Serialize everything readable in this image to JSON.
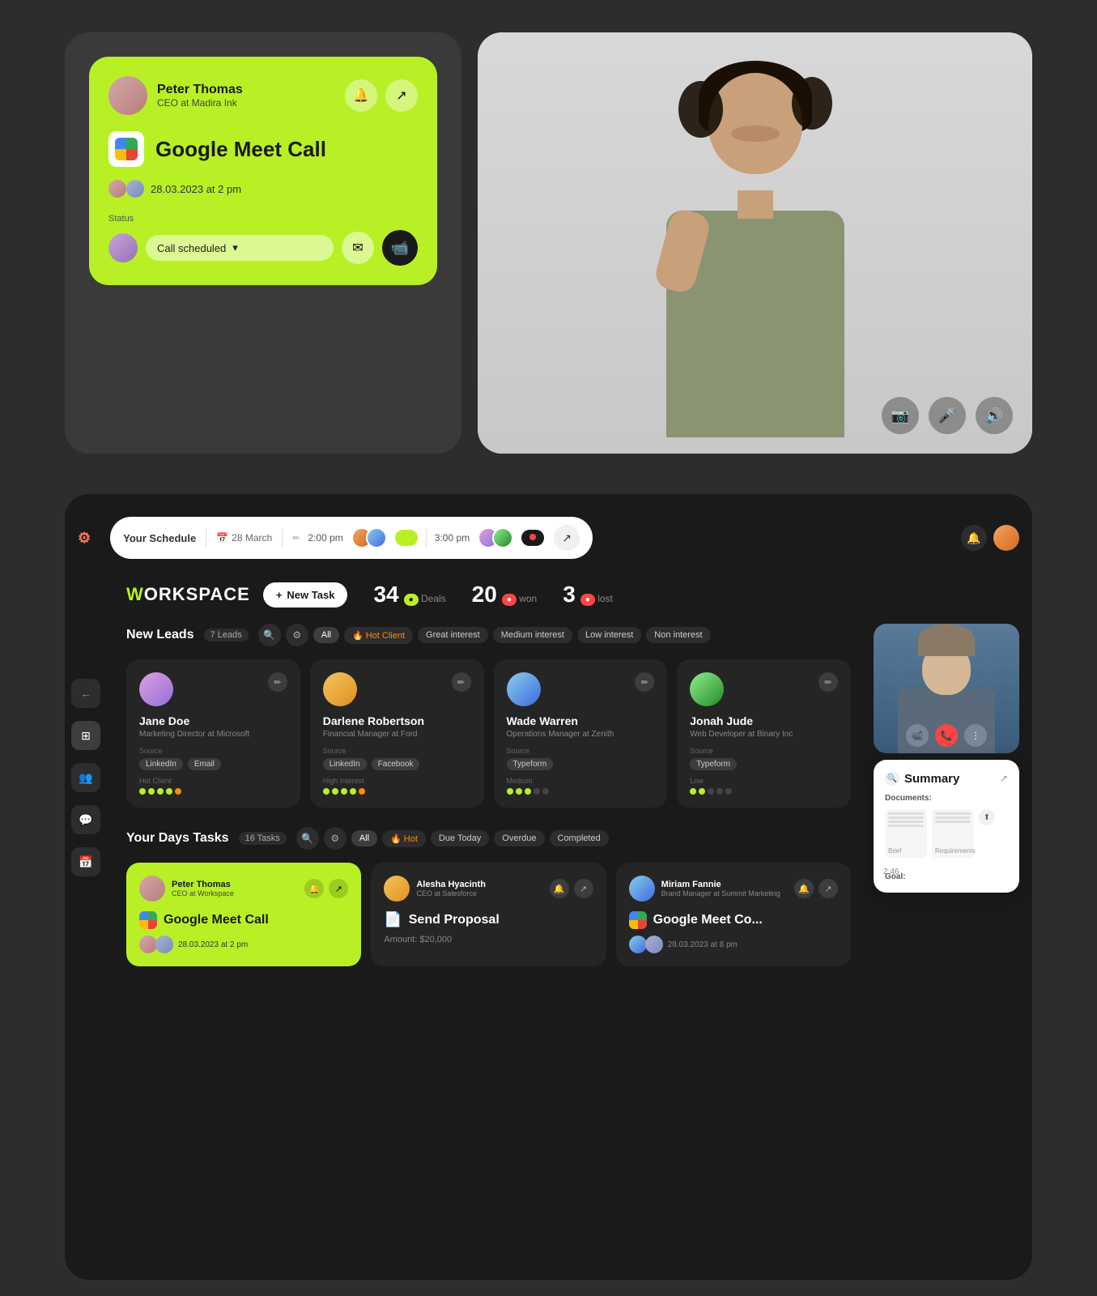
{
  "top_left_card": {
    "user_name": "Peter Thomas",
    "user_title": "CEO at Madira Ink",
    "bell_icon": "🔔",
    "expand_icon": "↗",
    "meet_title": "Google Meet Call",
    "meet_date": "28.03.2023",
    "meet_time": "at 2 pm",
    "status_label": "Status",
    "status_value": "Call scheduled",
    "chevron": "▾"
  },
  "video_call": {
    "camera_icon": "📷",
    "mic_icon": "🎤",
    "speaker_icon": "🔊"
  },
  "dashboard": {
    "schedule_label": "Your Schedule",
    "schedule_date": "28 March",
    "time1": "2:00 pm",
    "time2": "3:00 pm",
    "workspace_title": "W",
    "workspace_text": "ORKSPACE",
    "new_task_label": "New Task",
    "stats": {
      "deals_num": "34",
      "deals_label": "Deals",
      "won_num": "20",
      "won_label": "won",
      "lost_num": "3",
      "lost_label": "lost"
    },
    "new_leads": {
      "title": "New Leads",
      "count": "7 Leads",
      "filters": [
        "All",
        "Hot Client",
        "Great interest",
        "Medium interest",
        "Low interest",
        "Non interest"
      ]
    },
    "leads": [
      {
        "name": "Jane Doe",
        "role": "Marketing Director at Microsoft",
        "source_label": "Source",
        "sources": [
          "LinkedIn",
          "Email"
        ],
        "interest_label": "Hot Client",
        "dots": [
          "green",
          "green",
          "green",
          "green",
          "orange"
        ]
      },
      {
        "name": "Darlene Robertson",
        "role": "Financial Manager at Ford",
        "source_label": "Source",
        "sources": [
          "LinkedIn",
          "Facebook"
        ],
        "interest_label": "High Interest",
        "dots": [
          "green",
          "green",
          "green",
          "green",
          "orange"
        ]
      },
      {
        "name": "Wade Warren",
        "role": "Operations Manager at Zenith",
        "source_label": "Source",
        "sources": [
          "Typeform"
        ],
        "interest_label": "Medium",
        "dots": [
          "green",
          "green",
          "green",
          "gray",
          "gray"
        ]
      },
      {
        "name": "Jonah Jude",
        "role": "Web Developer at Binary Inc",
        "source_label": "Source",
        "sources": [
          "Typeform"
        ],
        "interest_label": "Low",
        "dots": [
          "green",
          "green",
          "gray",
          "gray",
          "gray"
        ]
      }
    ],
    "tasks": {
      "title": "Your Days Tasks",
      "count": "16 Tasks",
      "filters": [
        "All",
        "Hot",
        "Due Today",
        "Overdue",
        "Completed"
      ]
    },
    "task_cards": [
      {
        "user": "Peter Thomas",
        "role": "CEO at Workspace",
        "title": "Google Meet Call",
        "date": "28.03.2023",
        "time": "2 pm",
        "type": "green"
      },
      {
        "user": "Alesha Hyacinth",
        "role": "CEO at Salesforce",
        "title": "Send Proposal",
        "amount": "Amount: $20,000",
        "type": "dark"
      },
      {
        "user": "Miriam Fannie",
        "role": "Brand Manager at Summit Marketing",
        "title": "Google Meet Call",
        "date": "28.03.2023",
        "time": "8 pm",
        "type": "dark"
      }
    ]
  },
  "summary": {
    "title": "Summary",
    "documents_label": "Documents:",
    "goal_label": "Goal:",
    "time_indicator": "2:46"
  }
}
